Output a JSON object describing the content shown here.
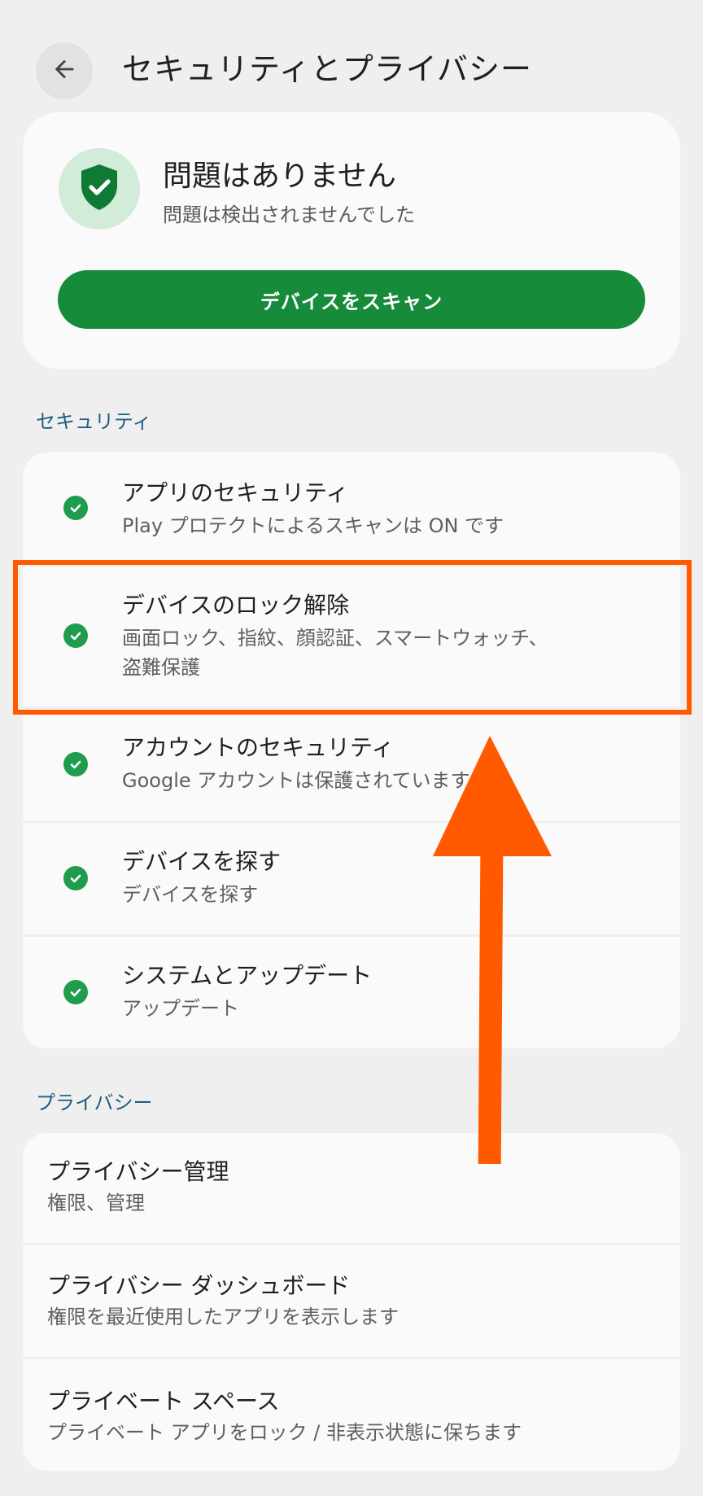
{
  "header": {
    "back_icon": "arrow-back-icon",
    "title": "セキュリティとプライバシー"
  },
  "status": {
    "icon": "shield-check-icon",
    "title": "問題はありません",
    "subtitle": "問題は検出されませんでした",
    "scan_button": "デバイスをスキャン"
  },
  "sections": {
    "security": "セキュリティ",
    "privacy": "プライバシー"
  },
  "security_items": [
    {
      "title": "アプリのセキュリティ",
      "subtitle": "Play プロテクトによるスキャンは ON です"
    },
    {
      "title": "デバイスのロック解除",
      "subtitle": "画面ロック、指紋、顔認証、スマートウォッチ、",
      "subtitle2": "盗難保護"
    },
    {
      "title": "アカウントのセキュリティ",
      "subtitle": "Google アカウントは保護されています"
    },
    {
      "title": "デバイスを探す",
      "subtitle": "デバイスを探す"
    },
    {
      "title": "システムとアップデート",
      "subtitle": "アップデート"
    }
  ],
  "privacy_items": [
    {
      "title": "プライバシー管理",
      "subtitle": "権限、管理"
    },
    {
      "title": "プライバシー ダッシュボード",
      "subtitle": "権限を最近使用したアプリを表示します"
    },
    {
      "title": "プライベート スペース",
      "subtitle": "プライベート アプリをロック / 非表示状態に保ちます"
    }
  ],
  "colors": {
    "accent_green": "#168b3a",
    "check_green": "#1f9d4d",
    "section_blue": "#1e5f7f",
    "annotation_orange": "#ff5a00"
  }
}
